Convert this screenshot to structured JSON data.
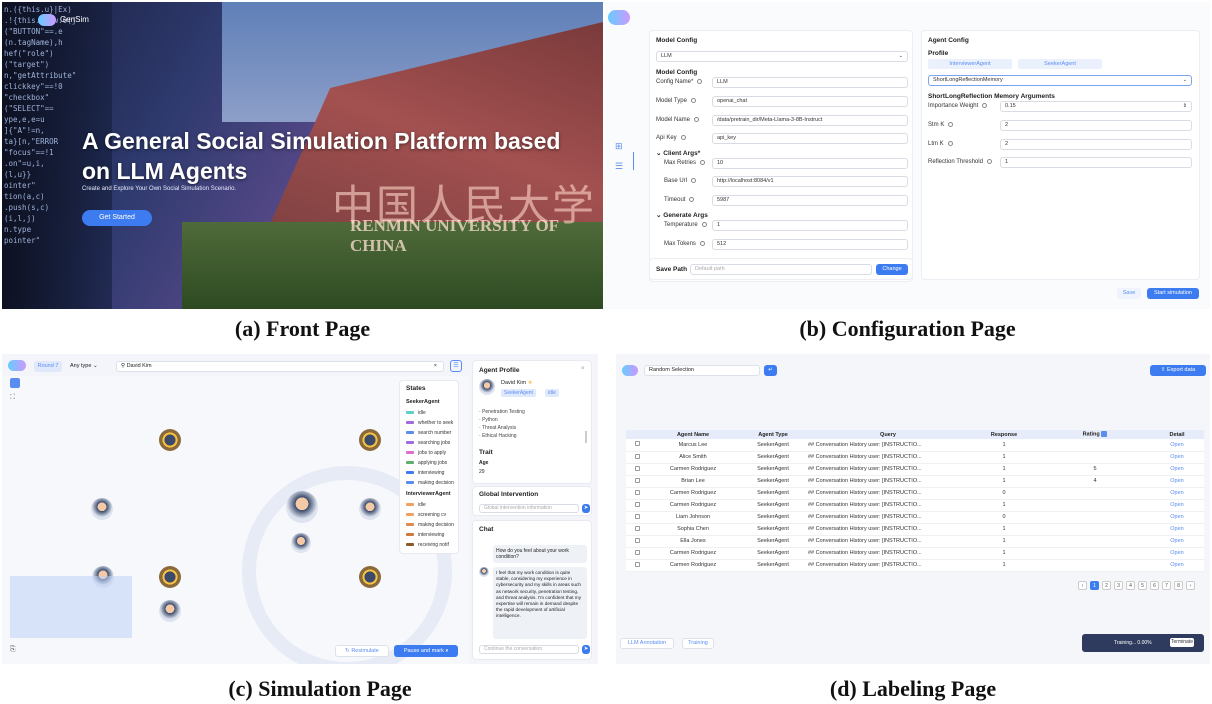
{
  "front": {
    "brand": "GenSim",
    "title": "A General Social Simulation Platform based on LLM Agents",
    "subtitle": "Create and Explore Your Own Social Simulation Scenario.",
    "cta": "Get Started",
    "banner_chinese": "中国人民大学",
    "banner_english": "RENMIN UNIVERSITY OF CHINA"
  },
  "config": {
    "model_config_heading": "Model Config",
    "model_select": "LLM",
    "model_config_sub": "Model Config",
    "fields": [
      {
        "label": "Config Name*",
        "value": "LLM"
      },
      {
        "label": "Model Type",
        "value": "openai_chat"
      },
      {
        "label": "Model Name",
        "value": "/data/pretrain_dir/Meta-Llama-3-8B-Instruct"
      },
      {
        "label": "Api Key",
        "value": "api_key"
      }
    ],
    "client_args_heading": "Client Args*",
    "client_args": [
      {
        "label": "Max Retries",
        "value": "10"
      },
      {
        "label": "Base Url",
        "value": "http://localhost:8084/v1"
      },
      {
        "label": "Timeout",
        "value": "5987"
      }
    ],
    "generate_args_heading": "Generate Args",
    "generate_args": [
      {
        "label": "Temperature",
        "value": "1"
      },
      {
        "label": "Max Tokens",
        "value": "512"
      }
    ],
    "save_path_label": "Save Path",
    "save_path_placeholder": "Default path",
    "change_button": "Change",
    "agent_config_heading": "Agent Config",
    "profile_label": "Profile",
    "profile_tabs": [
      "InterviewerAgent",
      "SeekerAgent"
    ],
    "memory_select": "ShortLongReflectionMemory",
    "memory_heading": "ShortLongReflection Memory Arguments",
    "memory_args": [
      {
        "label": "Importance Weight",
        "value": "0.15"
      },
      {
        "label": "Stm K",
        "value": "2"
      },
      {
        "label": "Ltm K",
        "value": "2"
      },
      {
        "label": "Reflection Threshold",
        "value": "1"
      }
    ],
    "save_button": "Save",
    "start_button": "Start simulation"
  },
  "simulation": {
    "round": "Round 7",
    "type_select": "Any type",
    "search_value": "David Kim",
    "states_heading": "States",
    "seeker_heading": "SeekerAgent",
    "seeker_states": [
      {
        "label": "idle",
        "color": "#5fd0c7"
      },
      {
        "label": "whether to seek",
        "color": "#a36be0"
      },
      {
        "label": "search number",
        "color": "#5b8df0"
      },
      {
        "label": "searching jobs",
        "color": "#a36be0"
      },
      {
        "label": "jobs to apply",
        "color": "#e06bd0"
      },
      {
        "label": "applying jobs",
        "color": "#5fb070"
      },
      {
        "label": "interviewing",
        "color": "#3d7cf0"
      },
      {
        "label": "making decision",
        "color": "#5b8df0"
      }
    ],
    "interviewer_heading": "InterviewerAgent",
    "interviewer_states": [
      {
        "label": "idle",
        "color": "#f0a060"
      },
      {
        "label": "screening cv",
        "color": "#f0a060"
      },
      {
        "label": "making decision",
        "color": "#e08a4a"
      },
      {
        "label": "interviewing",
        "color": "#d07a3a"
      },
      {
        "label": "receiving notif",
        "color": "#8a5a2a"
      }
    ],
    "profile_heading": "Agent Profile",
    "profile_name": "David Kim",
    "profile_role": "SeekerAgent",
    "profile_status": "idle",
    "skills": [
      "Penetration Testing",
      "Python",
      "Threat Analysis",
      "Ethical Hacking"
    ],
    "trait_heading": "Trait",
    "age_label": "Age",
    "age_value": "29",
    "intervention_heading": "Global Intervention",
    "intervention_placeholder": "Global intervention information",
    "chat_heading": "Chat",
    "chat_question": "How do you feel about your work condition?",
    "chat_answer": "I feel that my work condition is quite stable, considering my experience in cybersecurity and my skills in areas such as network security, penetration testing, and threat analysis. I'm confident that my expertise will remain in demand despite the rapid development of artificial intelligence.",
    "chat_placeholder": "Continue the conversation",
    "resimulate": "Resimulate",
    "pause_mark": "Pause and mark"
  },
  "labeling": {
    "selection": "Random Selection",
    "export": "Export data",
    "columns": [
      "Agent Name",
      "Agent Type",
      "Query",
      "Response",
      "Rating",
      "Detail"
    ],
    "rows": [
      [
        "Marcus Lee",
        "SeekerAgent",
        "## Conversation History user: [INSTRUCTIO...",
        "1",
        "",
        "Open"
      ],
      [
        "Alice Smith",
        "SeekerAgent",
        "## Conversation History user: [INSTRUCTIO...",
        "1",
        "",
        "Open"
      ],
      [
        "Carmen Rodriguez",
        "SeekerAgent",
        "## Conversation History user: [INSTRUCTIO...",
        "1",
        "5",
        "Open"
      ],
      [
        "Brian Lee",
        "SeekerAgent",
        "## Conversation History user: [INSTRUCTIO...",
        "1",
        "4",
        "Open"
      ],
      [
        "Carmen Rodriguez",
        "SeekerAgent",
        "## Conversation History user: [INSTRUCTIO...",
        "0",
        "",
        "Open"
      ],
      [
        "Carmen Rodriguez",
        "SeekerAgent",
        "## Conversation History user: [INSTRUCTIO...",
        "1",
        "",
        "Open"
      ],
      [
        "Liam Johnson",
        "SeekerAgent",
        "## Conversation History user: [INSTRUCTIO...",
        "0",
        "",
        "Open"
      ],
      [
        "Sophia Chen",
        "SeekerAgent",
        "## Conversation History user: [INSTRUCTIO...",
        "1",
        "",
        "Open"
      ],
      [
        "Ella Jones",
        "SeekerAgent",
        "## Conversation History user: [INSTRUCTIO...",
        "1",
        "",
        "Open"
      ],
      [
        "Carmen Rodriguez",
        "SeekerAgent",
        "## Conversation History user: [INSTRUCTIO...",
        "1",
        "",
        "Open"
      ],
      [
        "Carmen Rodriguez",
        "SeekerAgent",
        "## Conversation History user: [INSTRUCTIO...",
        "1",
        "",
        "Open"
      ]
    ],
    "pages": [
      "1",
      "2",
      "3",
      "4",
      "5",
      "6",
      "7",
      "8"
    ],
    "llm_annotation": "LLM Annotation",
    "training": "Training",
    "training_status": "Training... 0.00%",
    "terminate": "Terminate"
  },
  "captions": [
    "(a) Front Page",
    "(b) Configuration Page",
    "(c) Simulation Page",
    "(d) Labeling Page"
  ]
}
